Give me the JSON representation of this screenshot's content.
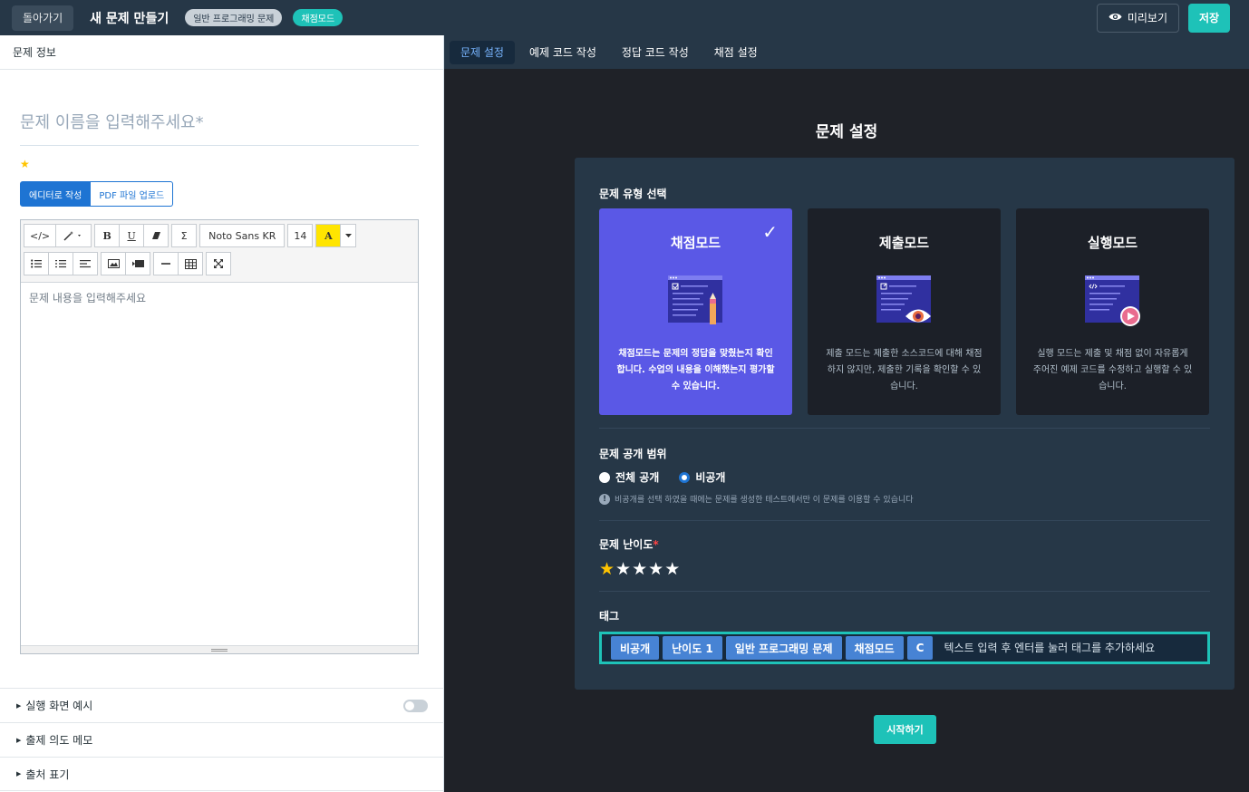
{
  "header": {
    "back_label": "돌아가기",
    "title": "새 문제 만들기",
    "badge_type": "일반 프로그래밍 문제",
    "badge_mode": "채점모드",
    "preview_label": "미리보기",
    "save_label": "저장"
  },
  "left": {
    "section_label": "문제 정보",
    "name_placeholder": "문제 이름을 입력해주세요*",
    "mode_options": [
      "에디터로 작성",
      "PDF 파일 업로드"
    ],
    "toolbar": {
      "font_family": "Noto Sans KR",
      "font_size": "14",
      "highlight_glyph": "A",
      "code_glyph": "</>",
      "bold_glyph": "B",
      "underline_glyph": "U",
      "formula_glyph": "Σ"
    },
    "editor_placeholder": "문제 내용을 입력해주세요",
    "accordions": [
      "실행 화면 예시",
      "출제 의도 메모",
      "출처 표기"
    ]
  },
  "tabs": [
    "문제 설정",
    "예제 코드 작성",
    "정답 코드 작성",
    "채점 설정"
  ],
  "settings": {
    "title": "문제 설정",
    "type_label": "문제 유형 선택",
    "cards": [
      {
        "title": "채점모드",
        "desc": "채점모드는 문제의 정답을 맞췄는지 확인합니다. 수업의 내용을 이해했는지 평가할 수 있습니다.",
        "selected": true
      },
      {
        "title": "제출모드",
        "desc": "제출 모드는 제출한 소스코드에 대해 채점하지 않지만, 제출한 기록을 확인할 수 있습니다.",
        "selected": false
      },
      {
        "title": "실행모드",
        "desc": "실행 모드는 제출 및 채점 없이 자유롭게 주어진 예제 코드를 수정하고 실행할 수 있습니다.",
        "selected": false
      }
    ],
    "visibility_label": "문제 공개 범위",
    "visibility_options": [
      "전체 공개",
      "비공개"
    ],
    "visibility_selected": "비공개",
    "visibility_hint": "비공개를 선택 하였을 때에는 문제를 생성한 테스트에서만 이 문제를 이용할 수 있습니다",
    "difficulty_label": "문제 난이도",
    "difficulty_required": "*",
    "difficulty_value": 1,
    "difficulty_max": 5,
    "tags_label": "태그",
    "tags": [
      "비공개",
      "난이도 1",
      "일반 프로그래밍 문제",
      "채점모드",
      "C"
    ],
    "tag_placeholder": "텍스트 입력 후 엔터를 눌러 태그를 추가하세요",
    "start_label": "시작하기"
  },
  "colors": {
    "accent_teal": "#1ec2b8",
    "selected_card": "#5a58e6",
    "primary_blue": "#1e74d3",
    "star": "#ffc400"
  }
}
